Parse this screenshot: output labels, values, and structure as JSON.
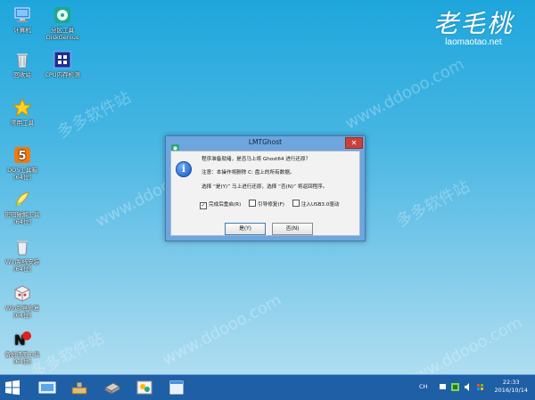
{
  "desktop": {
    "icons": [
      {
        "label": "计算机",
        "icon": "computer-icon"
      },
      {
        "label": "分区工具\nDiskGenius",
        "icon": "diskgenius-icon"
      },
      {
        "label": "回收站",
        "icon": "recycle-bin-icon"
      },
      {
        "label": "CPU内存检测",
        "icon": "cpu-test-icon"
      },
      {
        "label": "常用工具",
        "icon": "star-icon"
      },
      {
        "label": "DOS工具箱\n[64位]",
        "icon": "dos-toolbox-icon"
      },
      {
        "label": "密码破解工具\n[64位]",
        "icon": "password-tool-icon"
      },
      {
        "label": "Win系统安装\n[64位]",
        "icon": "win-install-icon"
      },
      {
        "label": "Win引导修复\n[64位]",
        "icon": "boot-repair-icon"
      },
      {
        "label": "备份还原工具\n[64位]",
        "icon": "backup-tool-icon"
      }
    ]
  },
  "brand": {
    "name": "老毛桃",
    "url": "laomaotao.net"
  },
  "watermark": {
    "text_cn": "多多软件站",
    "text_url": "www.ddooo.com"
  },
  "dialog": {
    "title": "LMTGhost",
    "close_label": "✕",
    "line1": "程序准备就绪，是否马上将 Ghost64 进行还原？",
    "line2": "注意：本操作将删除 C: 盘上的所有数据。",
    "line3": "选择 “是(Y)” 马上进行还原，选择 “否(N)” 将返回程序。",
    "checkboxes": [
      {
        "label": "完成后重启(R)",
        "checked": true
      },
      {
        "label": "引导修复(F)",
        "checked": false
      },
      {
        "label": "注入USB3.0驱动",
        "checked": false
      }
    ],
    "yes_label": "是(Y)",
    "no_label": "否(N)"
  },
  "taskbar": {
    "apps": [
      "desktop-icon",
      "tools-icon",
      "drive-icon",
      "ghost-icon",
      "window-icon"
    ],
    "lang": "CH",
    "time": "22:33",
    "date": "2016/10/14"
  },
  "colors": {
    "taskbar": "#1f5fa6",
    "dialog_frame": "#6ea5dd",
    "close": "#c7423b"
  }
}
